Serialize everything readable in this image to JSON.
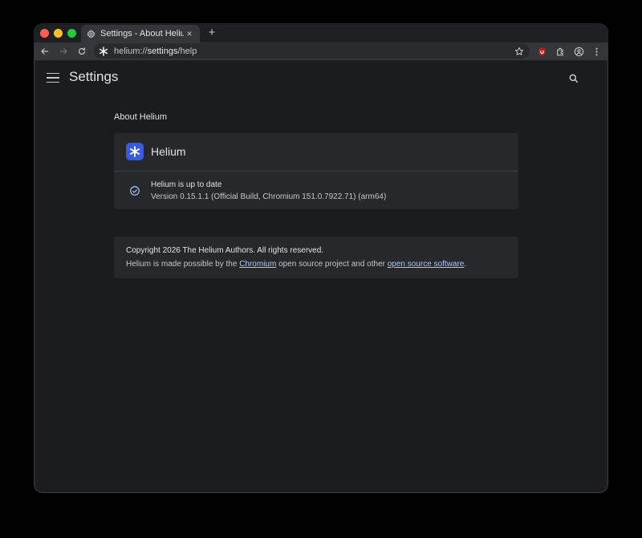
{
  "browser": {
    "tab_title": "Settings - About Helium",
    "tab_close": "×",
    "new_tab": "+",
    "url_scheme": "helium://",
    "url_host": "settings",
    "url_path": "/help"
  },
  "icons": {
    "back": "arrow-left-icon",
    "forward": "arrow-right-icon",
    "reload": "reload-icon",
    "site": "helium-logo-icon",
    "bookmark": "star-icon",
    "ublock": "ublock-shield-icon",
    "extensions": "puzzle-icon",
    "profile": "profile-icon",
    "menu": "more-vert-icon"
  },
  "colors": {
    "accent": "#3b5bdb",
    "link": "#a8c7fa",
    "ublock": "#b71c1c"
  },
  "settings": {
    "title": "Settings",
    "section_title": "About Helium",
    "product_name": "Helium",
    "status": "Helium is up to date",
    "version": "Version 0.15.1.1 (Official Build, Chromium 151.0.7922.71) (arm64)",
    "copyright": "Copyright 2026 The Helium Authors. All rights reserved.",
    "credits_prefix": "Helium is made possible by the ",
    "credits_link1": "Chromium",
    "credits_middle": " open source project and other ",
    "credits_link2": "open source software",
    "credits_suffix": "."
  }
}
